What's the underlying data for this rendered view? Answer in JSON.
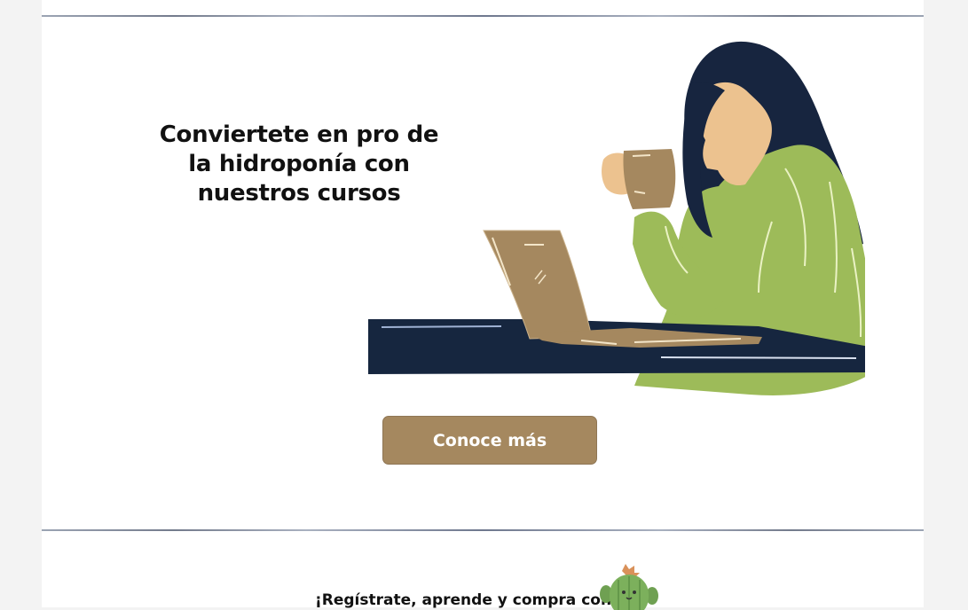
{
  "hero": {
    "title": "Conviertete en pro de la hidroponía con nuestros cursos",
    "illustration": "woman-drinking-coffee-at-laptop",
    "cta_label": "Conoce más"
  },
  "signup": {
    "text": "¡Regístrate, aprende y compra con",
    "mascot": "cactus-mascot"
  },
  "colors": {
    "button": "#a5885f",
    "sweater": "#9dbb59",
    "hair": "#17253f",
    "skin": "#ecc28f",
    "table": "#16263f"
  }
}
